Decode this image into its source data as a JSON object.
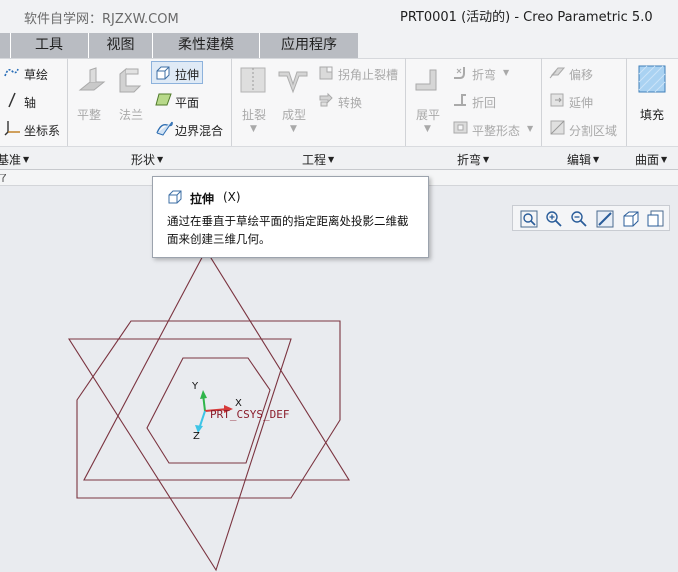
{
  "window": {
    "watermark": "软件自学网：RJZXW.COM",
    "title": "PRT0001 (活动的) - Creo Parametric 5.0"
  },
  "tabs": [
    {
      "label": "工具"
    },
    {
      "label": "视图"
    },
    {
      "label": "柔性建模"
    },
    {
      "label": "应用程序"
    }
  ],
  "ribbon": {
    "datum": {
      "sketch": "草绘",
      "axis": "轴",
      "csys": "坐标系",
      "group": "基准"
    },
    "shape": {
      "flatten": "平整",
      "flange": "法兰",
      "extrude": "拉伸",
      "plane": "平面",
      "blend": "边界混合",
      "group": "形状"
    },
    "engineering": {
      "rip": "扯裂",
      "form": "成型",
      "corner_relief": "拐角止裂槽",
      "convert": "转换",
      "group": "工程"
    },
    "bend": {
      "unbend": "展平",
      "bend": "折弯",
      "bend_back": "折回",
      "flat_pattern": "平整形态",
      "group": "折弯"
    },
    "edit": {
      "offset": "偏移",
      "extend": "延伸",
      "split_area": "分割区域",
      "group": "编辑"
    },
    "surface": {
      "fill": "填充",
      "group": "曲面"
    }
  },
  "tooltip": {
    "title": "拉伸",
    "shortcut": "(X)",
    "description": "通过在垂直于草绘平面的指定距离处投影二维截面来创建三维几何。"
  },
  "graphics": {
    "csys_name": "PRT_CSYS_DEF",
    "axis_x": "X",
    "axis_y": "Y",
    "axis_z": "Z"
  },
  "colors": {
    "datum_line": "#7b3440",
    "tab_strip": "#b9bcc2",
    "canvas_bg": "#e9ebef"
  }
}
